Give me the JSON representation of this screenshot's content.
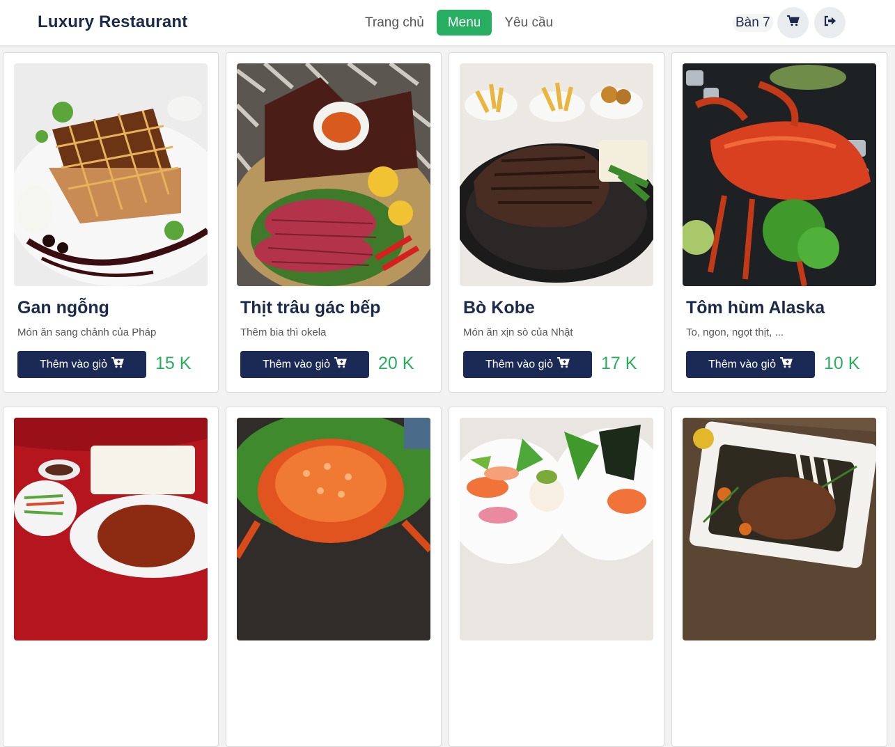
{
  "navbar": {
    "brand": "Luxury Restaurant",
    "links": [
      {
        "label": "Trang chủ",
        "active": false
      },
      {
        "label": "Menu",
        "active": true
      },
      {
        "label": "Yêu cầu",
        "active": false
      }
    ],
    "table_label": "Bàn 7",
    "cart_icon": "cart-icon",
    "logout_icon": "sign-out-icon"
  },
  "menu": {
    "add_label": "Thêm vào giỏ",
    "items": [
      {
        "name": "Gan ngỗng",
        "desc": "Món ăn sang chảnh của Pháp",
        "price": "15 K"
      },
      {
        "name": "Thịt trâu gác bếp",
        "desc": "Thêm bia thì okela",
        "price": "20 K"
      },
      {
        "name": "Bò Kobe",
        "desc": "Món ăn xịn sò của Nhật",
        "price": "17 K"
      },
      {
        "name": "Tôm hùm Alaska",
        "desc": "To, ngon, ngọt thịt, ...",
        "price": "10 K"
      }
    ]
  },
  "colors": {
    "brand": "#1b2a4a",
    "accent": "#27ae60",
    "button": "#1b2a55"
  }
}
